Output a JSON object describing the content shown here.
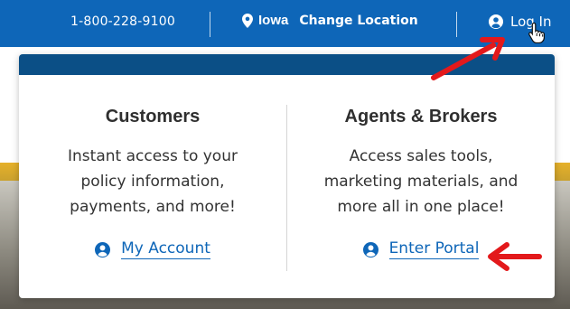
{
  "topbar": {
    "phone": "1-800-228-9100",
    "location_state": "Iowa",
    "change_location_label": "Change Location",
    "login_label": "Log In"
  },
  "dropdown": {
    "customers": {
      "title": "Customers",
      "description": "Instant access to your policy information, payments, and more!",
      "link_label": "My Account"
    },
    "agents": {
      "title": "Agents & Brokers",
      "description": "Access sales tools, marketing materials, and more all in one place!",
      "link_label": "Enter Portal"
    }
  },
  "icons": {
    "location": "map-pin-icon",
    "user": "user-circle-icon",
    "cursor": "hand-pointer-icon"
  },
  "colors": {
    "topbar": "#0e66b8",
    "panel_header": "#0b4f86",
    "link": "#0e66b8",
    "annotation_arrow": "#e3191b"
  }
}
